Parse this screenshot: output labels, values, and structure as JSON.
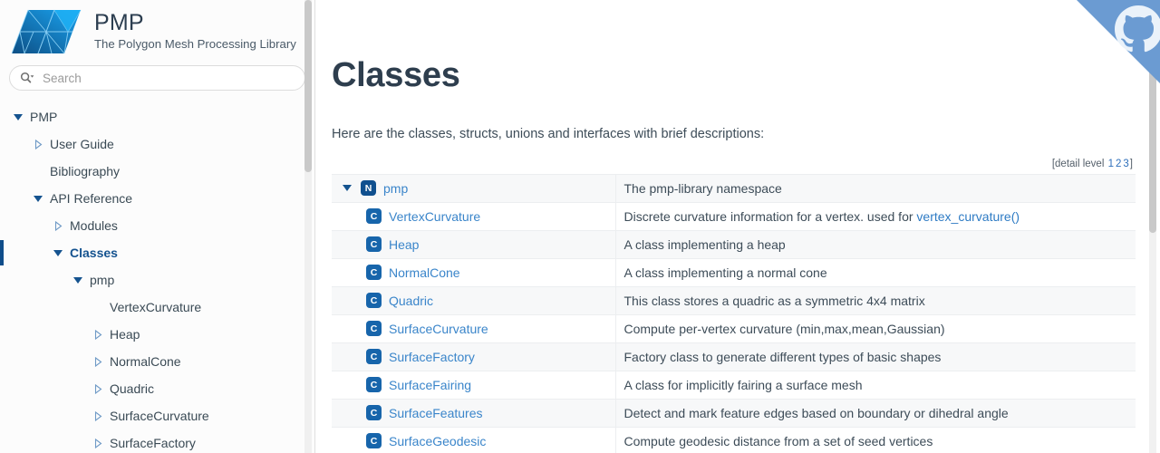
{
  "brand": {
    "title": "PMP",
    "subtitle": "The Polygon Mesh Processing Library",
    "logo_icon": "pmp-mesh-logo-icon"
  },
  "search": {
    "placeholder": "Search",
    "value": "",
    "icon": "search-icon"
  },
  "sidebar": {
    "items": [
      {
        "label": "PMP",
        "indent": 0,
        "state": "expanded",
        "selected": false
      },
      {
        "label": "User Guide",
        "indent": 1,
        "state": "collapsed",
        "selected": false
      },
      {
        "label": "Bibliography",
        "indent": 1,
        "state": "leaf",
        "selected": false
      },
      {
        "label": "API Reference",
        "indent": 1,
        "state": "expanded",
        "selected": false
      },
      {
        "label": "Modules",
        "indent": 2,
        "state": "collapsed",
        "selected": false
      },
      {
        "label": "Classes",
        "indent": 2,
        "state": "expanded",
        "selected": true
      },
      {
        "label": "pmp",
        "indent": 3,
        "state": "expanded",
        "selected": false
      },
      {
        "label": "VertexCurvature",
        "indent": 4,
        "state": "leaf",
        "selected": false
      },
      {
        "label": "Heap",
        "indent": 4,
        "state": "collapsed",
        "selected": false
      },
      {
        "label": "NormalCone",
        "indent": 4,
        "state": "collapsed",
        "selected": false
      },
      {
        "label": "Quadric",
        "indent": 4,
        "state": "collapsed",
        "selected": false
      },
      {
        "label": "SurfaceCurvature",
        "indent": 4,
        "state": "collapsed",
        "selected": false
      },
      {
        "label": "SurfaceFactory",
        "indent": 4,
        "state": "collapsed",
        "selected": false
      }
    ]
  },
  "main": {
    "title": "Classes",
    "intro": "Here are the classes, structs, unions and interfaces with brief descriptions:",
    "detail_level": {
      "prefix": "[detail level ",
      "levels": [
        "1",
        "2",
        "3"
      ],
      "suffix": "]"
    },
    "rows": [
      {
        "twisty": "expanded",
        "badge": "N",
        "badge_type": "namespace",
        "name": "pmp",
        "desc": "The pmp-library namespace",
        "desc_link": ""
      },
      {
        "twisty": "none",
        "badge": "C",
        "badge_type": "class",
        "name": "VertexCurvature",
        "desc": "Discrete curvature information for a vertex. used for ",
        "desc_link": "vertex_curvature()"
      },
      {
        "twisty": "none",
        "badge": "C",
        "badge_type": "class",
        "name": "Heap",
        "desc": "A class implementing a heap",
        "desc_link": ""
      },
      {
        "twisty": "none",
        "badge": "C",
        "badge_type": "class",
        "name": "NormalCone",
        "desc": "A class implementing a normal cone",
        "desc_link": ""
      },
      {
        "twisty": "none",
        "badge": "C",
        "badge_type": "class",
        "name": "Quadric",
        "desc": "This class stores a quadric as a symmetric 4x4 matrix",
        "desc_link": ""
      },
      {
        "twisty": "none",
        "badge": "C",
        "badge_type": "class",
        "name": "SurfaceCurvature",
        "desc": "Compute per-vertex curvature (min,max,mean,Gaussian)",
        "desc_link": ""
      },
      {
        "twisty": "none",
        "badge": "C",
        "badge_type": "class",
        "name": "SurfaceFactory",
        "desc": "Factory class to generate different types of basic shapes",
        "desc_link": ""
      },
      {
        "twisty": "none",
        "badge": "C",
        "badge_type": "class",
        "name": "SurfaceFairing",
        "desc": "A class for implicitly fairing a surface mesh",
        "desc_link": ""
      },
      {
        "twisty": "none",
        "badge": "C",
        "badge_type": "class",
        "name": "SurfaceFeatures",
        "desc": "Detect and mark feature edges based on boundary or dihedral angle",
        "desc_link": ""
      },
      {
        "twisty": "none",
        "badge": "C",
        "badge_type": "class",
        "name": "SurfaceGeodesic",
        "desc": "Compute geodesic distance from a set of seed vertices",
        "desc_link": ""
      }
    ]
  },
  "ribbon": {
    "icon": "github-octocat-icon",
    "background": "#6b9bd2"
  },
  "colors": {
    "accent_blue": "#1765ab",
    "link_blue": "#3a85ca",
    "selected_blue": "#14528f",
    "title_dark": "#2e3e4e",
    "row_stripe": "#f7f8f9"
  }
}
